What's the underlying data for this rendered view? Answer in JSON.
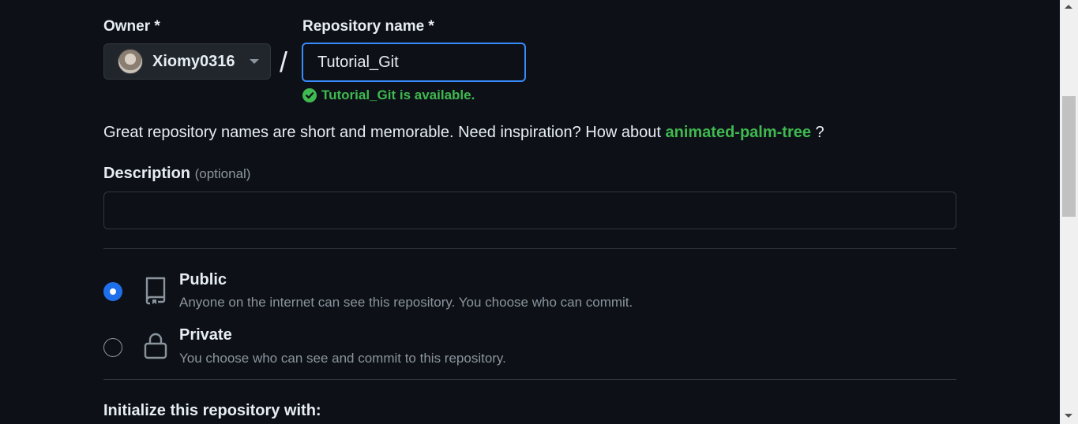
{
  "form": {
    "owner_label": "Owner *",
    "owner_value": "Xiomy0316",
    "repo_label": "Repository name *",
    "repo_value": "Tutorial_Git",
    "available_message": "Tutorial_Git is available.",
    "hint_text": "Great repository names are short and memorable. Need inspiration? How about ",
    "hint_suggestion": "animated-palm-tree",
    "hint_end": " ?",
    "description_label": "Description",
    "description_optional": "(optional)",
    "description_value": "",
    "init_label": "Initialize this repository with:"
  },
  "visibility": {
    "selected": "Public",
    "options": [
      {
        "title": "Public",
        "description": "Anyone on the internet can see this repository. You choose who can commit.",
        "icon": "repo-icon"
      },
      {
        "title": "Private",
        "description": "You choose who can see and commit to this repository.",
        "icon": "lock-icon"
      }
    ]
  },
  "colors": {
    "background": "#0d1117",
    "success": "#3fb950",
    "accent": "#1f6feb",
    "focus_border": "#388bfd",
    "muted_text": "#8b949e"
  }
}
